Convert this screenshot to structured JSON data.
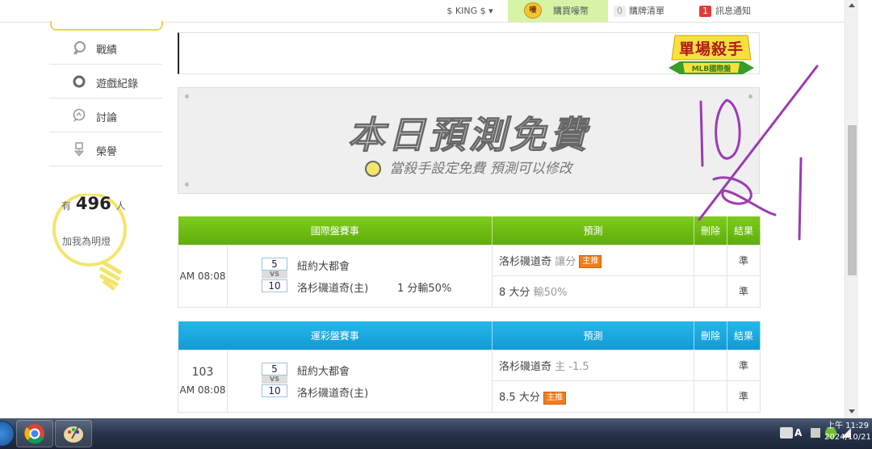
{
  "topbar": {
    "user_menu": "$ KING $ ▾",
    "buy_label": "購買嚎幣",
    "coin_glyph": "嚎",
    "cart_count": "0",
    "cart_label": "購牌清單",
    "msg_count": "1",
    "msg_label": "訊息通知"
  },
  "sidebar": {
    "items": [
      {
        "label": "戰績",
        "icon": "medal-icon"
      },
      {
        "label": "遊戲紀錄",
        "icon": "ring-icon"
      },
      {
        "label": "討論",
        "icon": "chat-icon"
      },
      {
        "label": "榮譽",
        "icon": "trophy-icon"
      }
    ],
    "fans": {
      "prefix": "有",
      "count": "496",
      "suffix": "人",
      "cta": "加我為明燈"
    }
  },
  "badge": {
    "title": "單場殺手",
    "subtitle": "MLB國際盤"
  },
  "banner": {
    "title": "本日預測免費",
    "subtitle": "當殺手設定免費  預測可以修改"
  },
  "table_intl": {
    "headers": [
      "國際盤賽事",
      "預測",
      "刪除",
      "結果"
    ],
    "time": "AM 08:08",
    "away_score": "5",
    "away_team": "紐約大都會",
    "vs": "VS",
    "home_score": "10",
    "home_team": "洛杉磯道奇(主)",
    "odds": "1 分輸50%",
    "pred1_team": "洛杉磯道奇",
    "pred1_detail": "讓分",
    "pred1_tag": "主推",
    "pred2_main": "8 大分",
    "pred2_detail": "輸50%",
    "result1": "準",
    "result2": "準"
  },
  "table_lottery": {
    "headers": [
      "運彩盤賽事",
      "預測",
      "刪除",
      "結果"
    ],
    "game_no": "103",
    "time": "AM 08:08",
    "away_score": "5",
    "away_team": "紐約大都會",
    "vs": "VS",
    "home_score": "10",
    "home_team": "洛杉磯道奇(主)",
    "pred1_team": "洛杉磯道奇",
    "pred1_detail": "主 -1.5",
    "pred2_main": "8.5 大分",
    "pred2_tag": "主推",
    "result1": "準",
    "result2": "準"
  },
  "taskbar": {
    "clock_period_time": "上午 11:29",
    "clock_date": "2024/10/21",
    "ime_label": "A"
  },
  "colors": {
    "intl_header": "#6abf12",
    "lottery_header": "#1aa8df",
    "result": "#3aa300",
    "tag": "#ef7d1c",
    "fan_ring": "#f5e46a",
    "annotation": "#9b3bb0"
  }
}
